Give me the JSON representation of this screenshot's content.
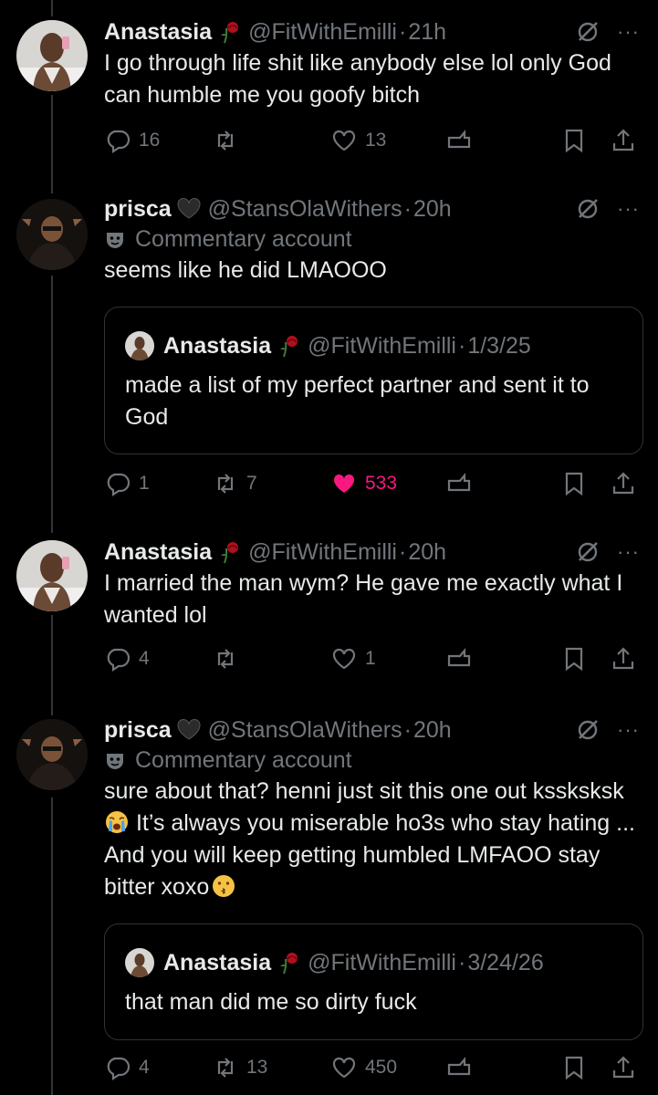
{
  "tweets": [
    {
      "name": "Anastasia",
      "handle": "@FitWithEmilli",
      "time": "21h",
      "text": "I go through life shit like anybody else lol only God can humble me you goofy bitch",
      "replies": "16",
      "reposts": "",
      "likes": "13",
      "liked": false
    },
    {
      "name": "prisca",
      "handle": "@StansOlaWithers",
      "time": "20h",
      "label": "Commentary account",
      "text": "seems like he did LMAOOO",
      "quote": {
        "name": "Anastasia",
        "handle": "@FitWithEmilli",
        "time": "1/3/25",
        "text": "made a list of my perfect partner and sent it to God"
      },
      "replies": "1",
      "reposts": "7",
      "likes": "533",
      "liked": true
    },
    {
      "name": "Anastasia",
      "handle": "@FitWithEmilli",
      "time": "20h",
      "text": "I married the man wym? He gave me exactly what I wanted lol",
      "replies": "4",
      "reposts": "",
      "likes": "1",
      "liked": false
    },
    {
      "name": "prisca",
      "handle": "@StansOlaWithers",
      "time": "20h",
      "label": "Commentary account",
      "text_a": "sure about that? henni  just sit this one out kssksksk",
      "text_b": " It’s always you miserable ho3s who stay hating ... And you will keep getting humbled LMFAOO stay bitter xoxo",
      "quote": {
        "name": "Anastasia",
        "handle": "@FitWithEmilli",
        "time": "3/24/26",
        "text": "that man did me so dirty fuck"
      },
      "replies": "4",
      "reposts": "13",
      "likes": "450",
      "liked": false
    }
  ],
  "sep": "·",
  "more": "···",
  "colors": {
    "background": "#000000",
    "text": "#e7e9ea",
    "muted": "#71767b",
    "like": "#f91880",
    "border": "#2f3336"
  },
  "icons": [
    "reply-icon",
    "repost-icon",
    "like-icon",
    "views-icon",
    "bookmark-icon",
    "share-icon",
    "grok-icon",
    "more-icon",
    "commentary-mask-icon",
    "rose-emoji",
    "heart-emoji",
    "crying-emoji",
    "kissing-emoji"
  ]
}
